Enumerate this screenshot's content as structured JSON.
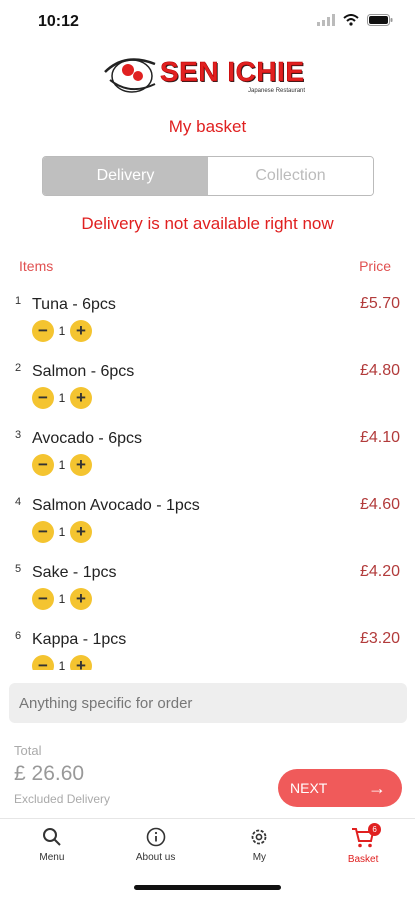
{
  "status": {
    "time": "10:12"
  },
  "logo": {
    "name": "SEN ICHIE",
    "subtitle": "Japanese Restaurant"
  },
  "page_title": "My basket",
  "segments": {
    "delivery": "Delivery",
    "collection": "Collection",
    "selected": "Delivery"
  },
  "notice": "Delivery is not available right now",
  "columns": {
    "items": "Items",
    "price": "Price"
  },
  "items": [
    {
      "num": "1",
      "name": "Tuna - 6pcs",
      "qty": "1",
      "price": "£5.70"
    },
    {
      "num": "2",
      "name": "Salmon - 6pcs",
      "qty": "1",
      "price": "£4.80"
    },
    {
      "num": "3",
      "name": "Avocado - 6pcs",
      "qty": "1",
      "price": "£4.10"
    },
    {
      "num": "4",
      "name": "Salmon Avocado - 1pcs",
      "qty": "1",
      "price": "£4.60"
    },
    {
      "num": "5",
      "name": "Sake - 1pcs",
      "qty": "1",
      "price": "£4.20"
    },
    {
      "num": "6",
      "name": "Kappa - 1pcs",
      "qty": "1",
      "price": "£3.20"
    }
  ],
  "stepper": {
    "minus": "−",
    "plus": "+"
  },
  "note": {
    "placeholder": "Anything specific for order"
  },
  "total": {
    "label": "Total",
    "value": "£ 26.60",
    "note": "Excluded Delivery"
  },
  "next_button": {
    "label": "NEXT",
    "arrow": "→"
  },
  "tabbar": {
    "menu": "Menu",
    "about": "About us",
    "my": "My",
    "basket": "Basket",
    "basket_count": "6",
    "active": "Basket"
  },
  "colors": {
    "accent": "#e02020",
    "stepper": "#f4c430",
    "next": "#f05a5a"
  },
  "icons": [
    "signal-icon",
    "wifi-icon",
    "battery-icon",
    "search-icon",
    "info-icon",
    "gear-icon",
    "cart-icon",
    "arrow-right-icon"
  ]
}
